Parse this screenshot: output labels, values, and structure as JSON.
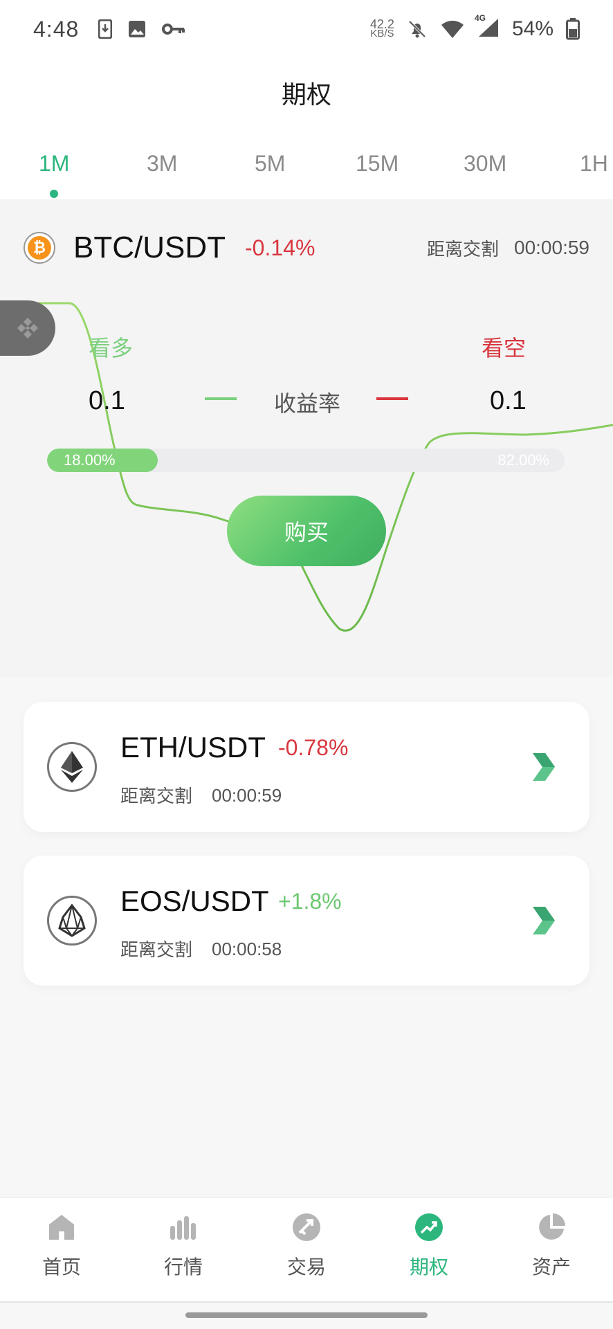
{
  "status_bar": {
    "time": "4:48",
    "speed_value": "42.2",
    "speed_unit": "KB/S",
    "network": "4G",
    "battery": "54%"
  },
  "header": {
    "title": "期权"
  },
  "tabs": {
    "items": [
      "1M",
      "3M",
      "5M",
      "15M",
      "30M",
      "1H"
    ],
    "active": "1M"
  },
  "btc": {
    "pair": "BTC/USDT",
    "change": "-0.14%",
    "countdown_label": "距离交割",
    "countdown": "00:00:59",
    "long_label": "看多",
    "short_label": "看空",
    "long_value": "0.1",
    "short_value": "0.1",
    "yield_label": "收益率",
    "long_pct": "18.00%",
    "short_pct": "82.00%",
    "long_fraction": 0.18,
    "buy_label": "购买"
  },
  "cards": [
    {
      "pair": "ETH/USDT",
      "change": "-0.78%",
      "countdown_label": "距离交割",
      "countdown": "00:00:59",
      "change_color": "#d9363e"
    },
    {
      "pair": "EOS/USDT",
      "change": "+1.8%",
      "countdown_label": "距离交割",
      "countdown": "00:00:58",
      "change_color": "#6cc870"
    }
  ],
  "nav": {
    "items": [
      {
        "label": "首页",
        "icon": "home-icon"
      },
      {
        "label": "行情",
        "icon": "market-bars-icon"
      },
      {
        "label": "交易",
        "icon": "trade-icon"
      },
      {
        "label": "期权",
        "icon": "options-trend-icon"
      },
      {
        "label": "资产",
        "icon": "assets-pie-icon"
      }
    ],
    "active": "期权"
  },
  "colors": {
    "accent": "#2cb67d",
    "up": "#7cd07f",
    "down": "#d9363e"
  }
}
